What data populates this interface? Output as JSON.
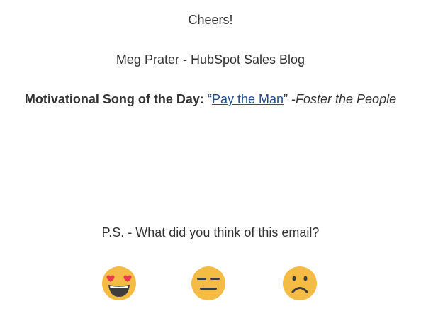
{
  "email": {
    "greeting": "Cheers!",
    "signature": "Meg Prater - HubSpot Sales Blog",
    "song": {
      "label": "Motivational Song of the Day:",
      "open_quote": "“",
      "title": "Pay the Man",
      "close_quote": "” -",
      "artist": "Foster the People"
    },
    "feedback_prompt": "P.S. - What did you think of this email?",
    "feedback_options": [
      {
        "icon": "heart-eyes-face-icon"
      },
      {
        "icon": "expressionless-face-icon"
      },
      {
        "icon": "frowning-face-icon"
      }
    ]
  },
  "colors": {
    "emoji_face": "#F5BC45",
    "emoji_features": "#3D3D3D",
    "hearts": "#E8394D",
    "link": "#1F4E8C",
    "text": "#333333"
  }
}
